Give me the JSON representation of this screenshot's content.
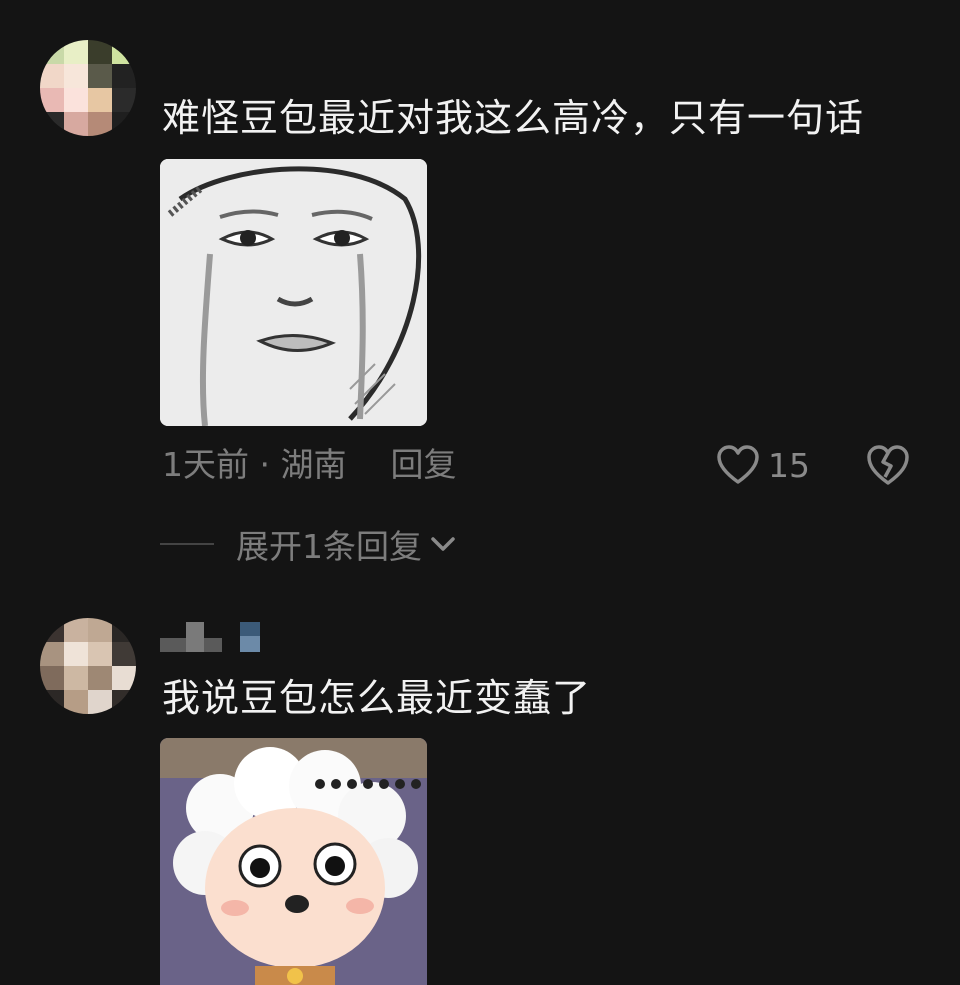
{
  "comments": [
    {
      "text": "难怪豆包最近对我这么高冷，只有一句话",
      "time": "1天前",
      "separator": " · ",
      "location": "湖南",
      "reply_label": "回复",
      "likes": "15",
      "expand_label": "展开1条回复",
      "image_desc": "crying-face-meme"
    },
    {
      "text": "我说豆包怎么最近变蠢了",
      "image_desc": "lazy-sheep-cartoon"
    }
  ],
  "colors": {
    "background": "#141414",
    "text_primary": "#f2f2f2",
    "text_secondary": "#7d7d7d"
  }
}
